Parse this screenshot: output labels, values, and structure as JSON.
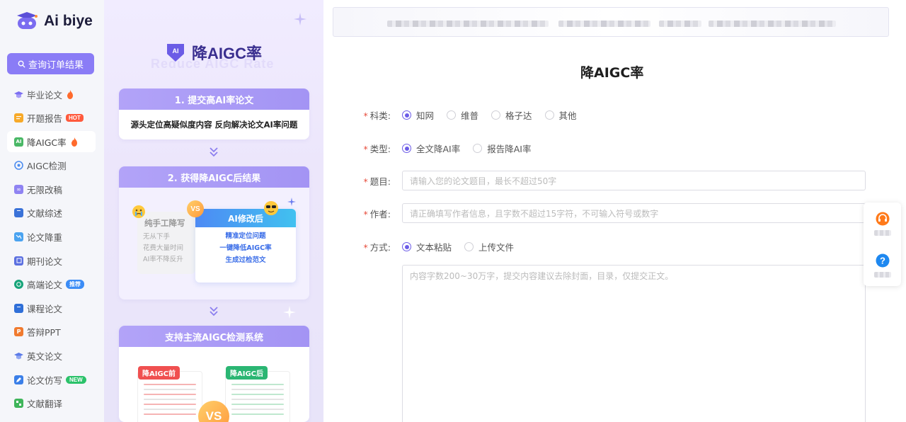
{
  "brand": {
    "name": "Ai biye"
  },
  "sidebar": {
    "search_label": "查询订单结果",
    "items": [
      {
        "label": "毕业论文",
        "badge": "flame"
      },
      {
        "label": "开题报告",
        "badge": "HOT"
      },
      {
        "label": "降AIGC率",
        "badge": "flame",
        "active": true
      },
      {
        "label": "AIGC检测"
      },
      {
        "label": "无限改稿"
      },
      {
        "label": "文献综述"
      },
      {
        "label": "论文降重"
      },
      {
        "label": "期刊论文"
      },
      {
        "label": "高端论文",
        "badge": "推荐"
      },
      {
        "label": "课程论文"
      },
      {
        "label": "答辩PPT"
      },
      {
        "label": "英文论文"
      },
      {
        "label": "论文仿写",
        "badge": "NEW"
      },
      {
        "label": "文献翻译"
      }
    ]
  },
  "promo": {
    "shield_text": "AI",
    "title": "降AIGC率",
    "subtitle": "Reduce AIGC Rate",
    "step1": {
      "title": "1. 提交高AI率论文",
      "body": "源头定位高疑似度内容 反向解决论文AI率问题"
    },
    "step2": {
      "title": "2. 获得降AIGC后结果",
      "left_title": "纯手工降写",
      "left_lines": [
        "无从下手",
        "花费大量时间",
        "AI率不降反升"
      ],
      "vs": "VS",
      "right_title": "AI修改后",
      "right_lines": [
        "精准定位问题",
        "一键降低AIGC率",
        "生成过检范文"
      ]
    },
    "step3": {
      "title": "支持主流AIGC检测系统",
      "before_tag": "降AIGC前",
      "after_tag": "降AIGC后",
      "vs": "VS"
    }
  },
  "form": {
    "title": "降AIGC率",
    "subject": {
      "label": "科类:",
      "options": [
        "知网",
        "维普",
        "格子达",
        "其他"
      ],
      "selected": 0
    },
    "type": {
      "label": "类型:",
      "options": [
        "全文降AI率",
        "报告降AI率"
      ],
      "selected": 0
    },
    "topic": {
      "label": "题目:",
      "placeholder": "请输入您的论文题目，最长不超过50字"
    },
    "author": {
      "label": "作者:",
      "placeholder": "请正确填写作者信息，且字数不超过15字符，不可输入符号或数字"
    },
    "method": {
      "label": "方式:",
      "options": [
        "文本粘贴",
        "上传文件"
      ],
      "selected": 0
    },
    "content": {
      "placeholder": "内容字数200~30万字，提交内容建议去除封面，目录，仅提交正文。"
    },
    "required_mark": "*"
  },
  "colors": {
    "accent": "#8a7cf6",
    "radio": "#6c5ce7",
    "required": "#e74c3c"
  }
}
